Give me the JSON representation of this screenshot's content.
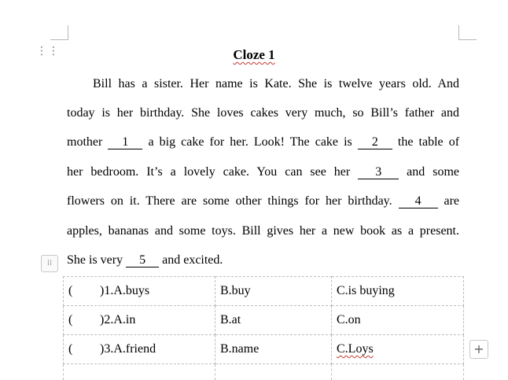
{
  "title": "Cloze 1",
  "passage": {
    "l1": "Bill has a sister. Her name is Kate. She is twelve years old. And",
    "l2": "today is her birthday. She loves cakes very much, so Bill’s father and",
    "l3a": "mother",
    "b1": "1",
    "l3b": "a big cake for her. Look! The cake is",
    "b2": "2",
    "l3c": "the table of",
    "l4a": "her bedroom. It’s a lovely cake. You can see her",
    "b3": "3",
    "l4b": "and some",
    "l5a": "flowers on it. There are some other things for her birthday.",
    "b4": "4",
    "l5b": "are",
    "l6": "apples, bananas and some toys. Bill gives her a new book as a present.",
    "l7a": "She is very",
    "b5": "5",
    "l7b": "and excited."
  },
  "questions": [
    {
      "paren": "(",
      "a": ")1.A.buys",
      "b": "B.buy",
      "c": "C.is buying"
    },
    {
      "paren": "(",
      "a": ")2.A.in",
      "b": "B.at",
      "c": "C.on"
    },
    {
      "paren": "(",
      "a": ")3.A.friend",
      "b": "B.name",
      "c": "C.Loys"
    }
  ]
}
